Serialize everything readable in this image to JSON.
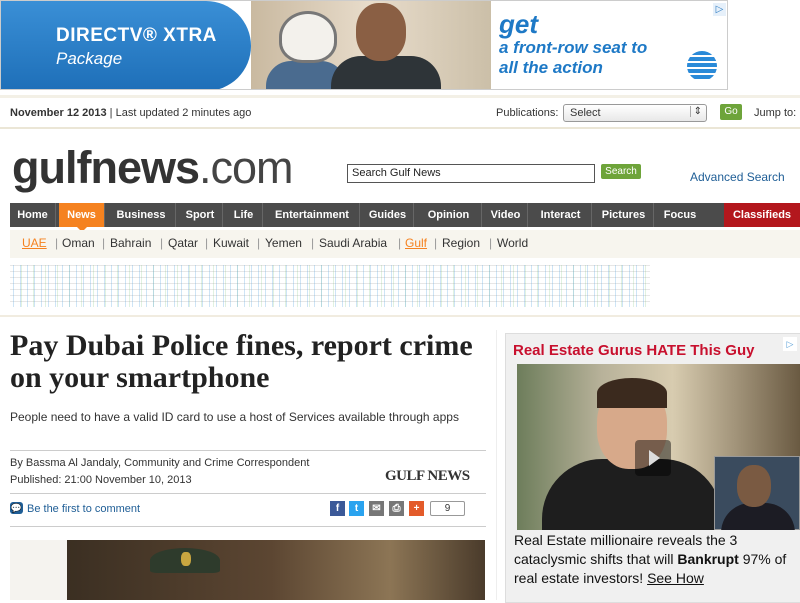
{
  "banner_ad": {
    "brand": "DIRECTV® XTRA",
    "package": "Package",
    "headline": "get",
    "tagline": "a front-row seat to all the action",
    "colors": {
      "brand_blue": "#1e79c6"
    }
  },
  "datebar": {
    "date": "November 12 2013",
    "updated": " | Last updated 2 minutes ago",
    "publications_label": "Publications:",
    "select_value": "Select",
    "go_label": "Go",
    "jump_label": "Jump to:"
  },
  "header": {
    "logo_main": "gulfnews",
    "logo_suffix": ".com",
    "search_value": "Search Gulf News",
    "search_button": "Search",
    "advanced_search": "Advanced Search"
  },
  "nav": {
    "items": [
      "Home",
      "News",
      "Business",
      "Sport",
      "Life",
      "Entertainment",
      "Guides",
      "Opinion",
      "Video",
      "Interact",
      "Pictures",
      "Focus"
    ],
    "active": "News",
    "classifieds": "Classifieds",
    "colors": {
      "active": "#f58220",
      "classifieds": "#b3171d",
      "bar": "#4b4b4b"
    }
  },
  "subnav": {
    "items": [
      "UAE",
      "Oman",
      "Bahrain",
      "Qatar",
      "Kuwait",
      "Yemen",
      "Saudi Arabia",
      "Gulf",
      "Region",
      "World"
    ]
  },
  "article": {
    "headline": "Pay Dubai Police fines, report crime on your smartphone",
    "standfirst": "People need to have a valid ID card to use a host of Services available through apps",
    "byline": "By Bassma Al Jandaly, Community and Crime Correspondent",
    "published": "Published: 21:00 November 10, 2013",
    "source_logo": "GULF NEWS",
    "comment_link": "Be the first to comment",
    "share_count": "9",
    "share_icons": [
      "facebook-icon",
      "twitter-icon",
      "email-icon",
      "print-icon",
      "plus-icon"
    ]
  },
  "right_ad": {
    "title": "Real Estate Gurus HATE This Guy",
    "text_1": "Real Estate millionaire reveals the 3 cataclysmic shifts that will ",
    "text_bold": "Bankrupt",
    "text_2": " 97% of real estate investors! ",
    "see_how": "See How"
  }
}
